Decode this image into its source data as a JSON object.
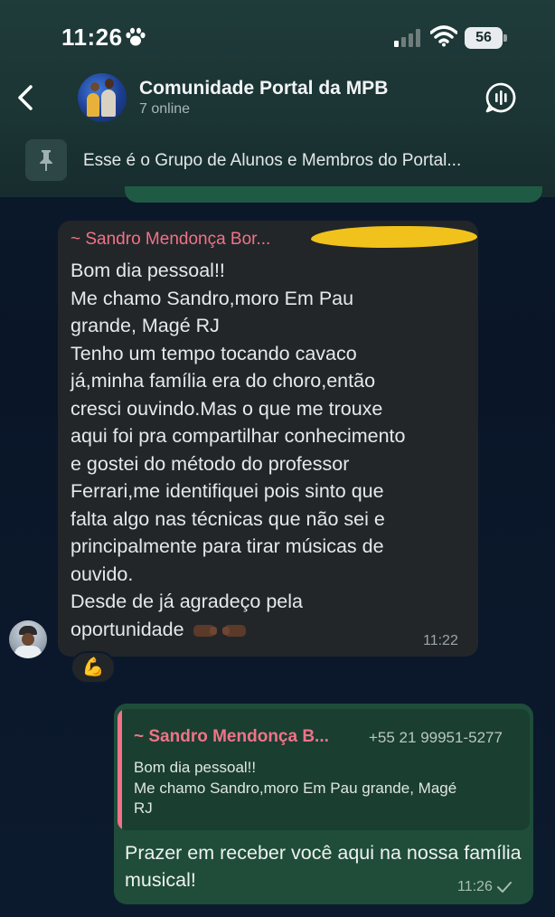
{
  "status_bar": {
    "time": "11:26",
    "battery": "56"
  },
  "header": {
    "title": "Comunidade Portal da MPB",
    "subtitle": "7 online"
  },
  "pinned": {
    "text": "Esse é o Grupo de Alunos e Membros do Portal..."
  },
  "incoming": {
    "sender": "~ Sandro Mendonça Bor...",
    "body": "Bom dia pessoal!!\n Me chamo Sandro,moro Em Pau\ngrande, Magé RJ\n Tenho um tempo tocando cavaco\njá,minha família era do choro,então\ncresci ouvindo.Mas o que me trouxe\naqui foi pra compartilhar conhecimento\ne gostei do método do professor\nFerrari,me identifiquei pois sinto que\nfalta algo nas técnicas que não sei e\nprincipalmente para tirar músicas de\nouvido.\nDesde de já agradeço pela\noportunidade",
    "time": "11:22",
    "reaction": "💪"
  },
  "outgoing": {
    "quote_sender": "~ Sandro Mendonça B...",
    "quote_phone": "+55 21 99951-5277",
    "quote_text": "Bom dia pessoal!!\n Me chamo Sandro,moro Em Pau grande, Magé\nRJ",
    "body": "Prazer em receber você aqui na nossa família musical!",
    "time": "11:26"
  },
  "colors": {
    "header_bg": "#1b3434",
    "chat_bg": "#0a1628",
    "incoming_bubble": "#222629",
    "outgoing_bubble": "#1f4d3a",
    "sender_name": "#f07388"
  }
}
